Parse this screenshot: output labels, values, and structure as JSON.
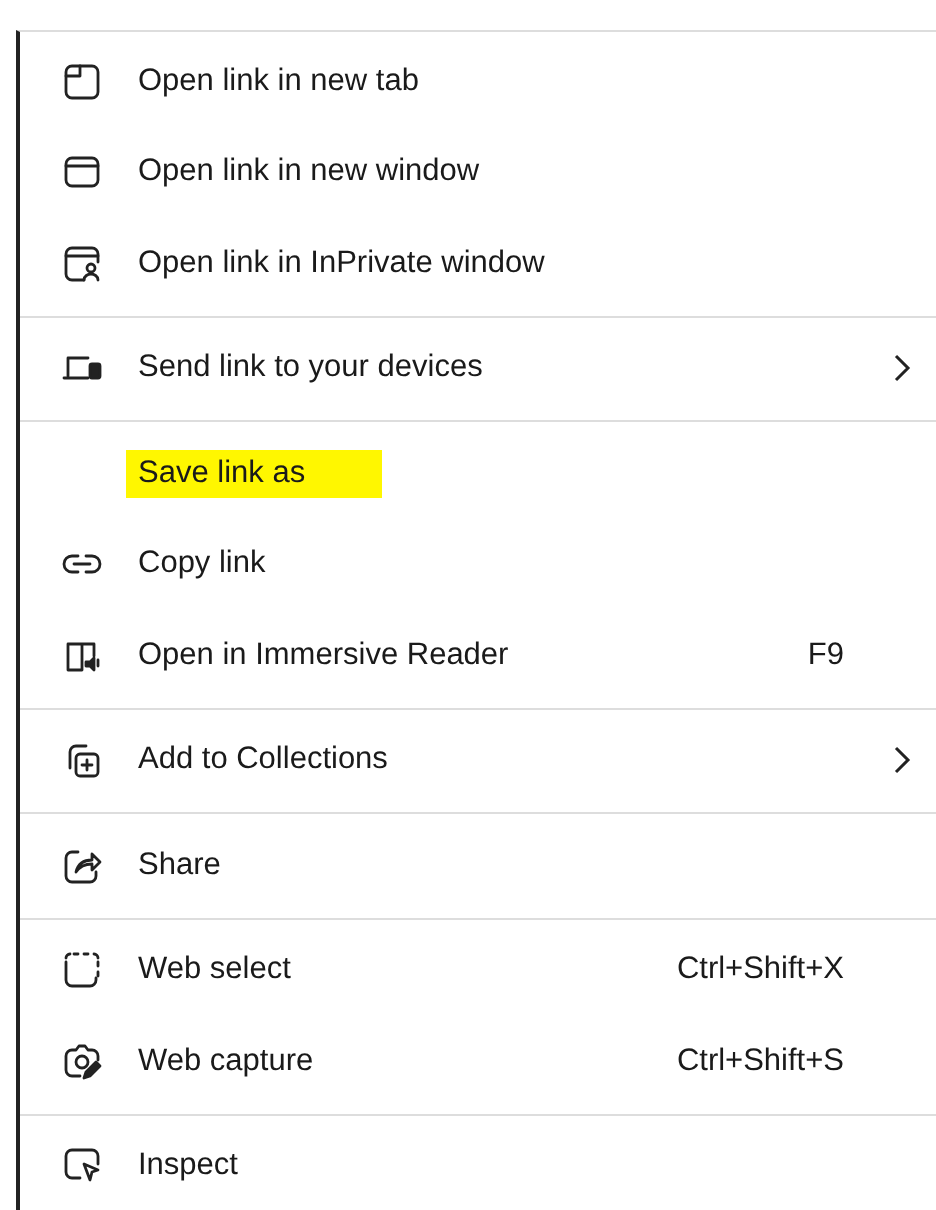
{
  "context_menu": {
    "sections": [
      {
        "items": [
          {
            "label": "Open link in new tab",
            "highlighted": false,
            "submenu": false
          },
          {
            "label": "Open link in new window",
            "highlighted": false,
            "submenu": false
          },
          {
            "label": "Open link in InPrivate window",
            "highlighted": false,
            "submenu": false
          }
        ]
      },
      {
        "items": [
          {
            "label": "Send link to your devices",
            "highlighted": false,
            "submenu": true
          }
        ]
      },
      {
        "items": [
          {
            "label": "Save link as",
            "highlighted": true,
            "submenu": false
          },
          {
            "label": "Copy link",
            "highlighted": false,
            "submenu": false
          },
          {
            "label": "Open in Immersive Reader",
            "shortcut": "F9",
            "highlighted": false,
            "submenu": false
          }
        ]
      },
      {
        "items": [
          {
            "label": "Add to Collections",
            "highlighted": false,
            "submenu": true
          }
        ]
      },
      {
        "items": [
          {
            "label": "Share",
            "highlighted": false,
            "submenu": false
          }
        ]
      },
      {
        "items": [
          {
            "label": "Web select",
            "shortcut": "Ctrl+Shift+X",
            "highlighted": false,
            "submenu": false
          },
          {
            "label": "Web capture",
            "shortcut": "Ctrl+Shift+S",
            "highlighted": false,
            "submenu": false
          }
        ]
      },
      {
        "items": [
          {
            "label": "Inspect",
            "highlighted": false,
            "submenu": false
          }
        ]
      }
    ]
  }
}
